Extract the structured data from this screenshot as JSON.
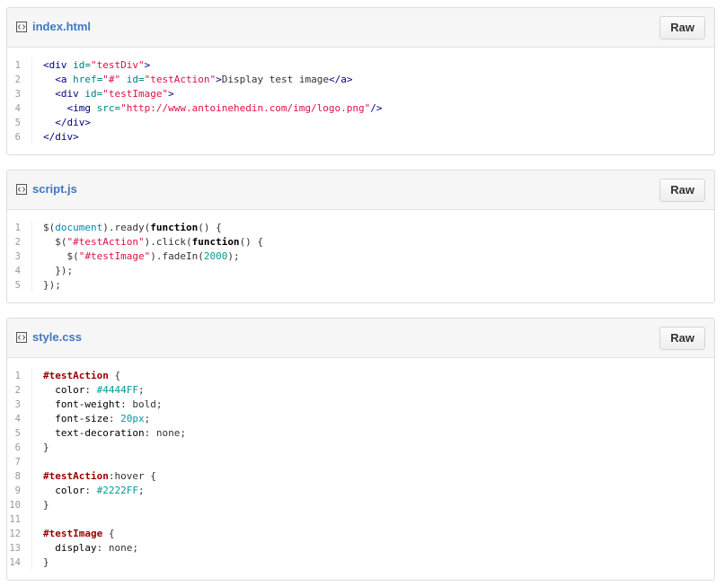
{
  "files": [
    {
      "name": "index.html",
      "raw_label": "Raw",
      "lines": [
        [
          [
            "t-tag",
            "<div "
          ],
          [
            "t-attr",
            "id="
          ],
          [
            "t-str",
            "\"testDiv\""
          ],
          [
            "t-tag",
            ">"
          ]
        ],
        [
          [
            "t-pc",
            "  "
          ],
          [
            "t-tag",
            "<a "
          ],
          [
            "t-attr",
            "href="
          ],
          [
            "t-str",
            "\"#\""
          ],
          [
            "t-attr",
            " id="
          ],
          [
            "t-str",
            "\"testAction\""
          ],
          [
            "t-tag",
            ">"
          ],
          [
            "t-pc",
            "Display test image"
          ],
          [
            "t-tag",
            "</a>"
          ]
        ],
        [
          [
            "t-pc",
            "  "
          ],
          [
            "t-tag",
            "<div "
          ],
          [
            "t-attr",
            "id="
          ],
          [
            "t-str",
            "\"testImage\""
          ],
          [
            "t-tag",
            ">"
          ]
        ],
        [
          [
            "t-pc",
            "    "
          ],
          [
            "t-tag",
            "<img "
          ],
          [
            "t-attr",
            "src="
          ],
          [
            "t-str",
            "\"http://www.antoinehedin.com/img/logo.png\""
          ],
          [
            "t-tag",
            "/>"
          ]
        ],
        [
          [
            "t-pc",
            "  "
          ],
          [
            "t-tag",
            "</div>"
          ]
        ],
        [
          [
            "t-tag",
            "</div>"
          ]
        ]
      ]
    },
    {
      "name": "script.js",
      "raw_label": "Raw",
      "lines": [
        [
          [
            "t-pc",
            "$("
          ],
          [
            "t-obj",
            "document"
          ],
          [
            "t-pc",
            ").ready("
          ],
          [
            "t-fn",
            "function"
          ],
          [
            "t-pc",
            "() {"
          ]
        ],
        [
          [
            "t-pc",
            "  $("
          ],
          [
            "t-str",
            "\"#testAction\""
          ],
          [
            "t-pc",
            ").click("
          ],
          [
            "t-fn",
            "function"
          ],
          [
            "t-pc",
            "() {"
          ]
        ],
        [
          [
            "t-pc",
            "    $("
          ],
          [
            "t-str",
            "\"#testImage\""
          ],
          [
            "t-pc",
            ").fadeIn("
          ],
          [
            "t-num",
            "2000"
          ],
          [
            "t-pc",
            ");"
          ]
        ],
        [
          [
            "t-pc",
            "  });"
          ]
        ],
        [
          [
            "t-pc",
            "});"
          ]
        ]
      ]
    },
    {
      "name": "style.css",
      "raw_label": "Raw",
      "lines": [
        [
          [
            "t-sel",
            "#testAction"
          ],
          [
            "t-pc",
            " {"
          ]
        ],
        [
          [
            "t-pc",
            "  "
          ],
          [
            "t-prop",
            "color"
          ],
          [
            "t-pc",
            ": "
          ],
          [
            "t-num",
            "#4444FF"
          ],
          [
            "t-pc",
            ";"
          ]
        ],
        [
          [
            "t-pc",
            "  "
          ],
          [
            "t-prop",
            "font-weight"
          ],
          [
            "t-pc",
            ": bold;"
          ]
        ],
        [
          [
            "t-pc",
            "  "
          ],
          [
            "t-prop",
            "font-size"
          ],
          [
            "t-pc",
            ": "
          ],
          [
            "t-num",
            "20px"
          ],
          [
            "t-pc",
            ";"
          ]
        ],
        [
          [
            "t-pc",
            "  "
          ],
          [
            "t-prop",
            "text-decoration"
          ],
          [
            "t-pc",
            ": none;"
          ]
        ],
        [
          [
            "t-pc",
            "}"
          ]
        ],
        [
          [
            "t-pc",
            ""
          ]
        ],
        [
          [
            "t-sel",
            "#testAction"
          ],
          [
            "t-pc",
            ":hover {"
          ]
        ],
        [
          [
            "t-pc",
            "  "
          ],
          [
            "t-prop",
            "color"
          ],
          [
            "t-pc",
            ": "
          ],
          [
            "t-num",
            "#2222FF"
          ],
          [
            "t-pc",
            ";"
          ]
        ],
        [
          [
            "t-pc",
            "}"
          ]
        ],
        [
          [
            "t-pc",
            ""
          ]
        ],
        [
          [
            "t-sel",
            "#testImage"
          ],
          [
            "t-pc",
            " {"
          ]
        ],
        [
          [
            "t-pc",
            "  "
          ],
          [
            "t-prop",
            "display"
          ],
          [
            "t-pc",
            ": none;"
          ]
        ],
        [
          [
            "t-pc",
            "}"
          ]
        ]
      ]
    }
  ],
  "icons": {
    "file": "file-code-icon"
  },
  "colors": {
    "link": "#4078c0",
    "header_bg": "#f6f6f6",
    "border": "#dddddd"
  }
}
